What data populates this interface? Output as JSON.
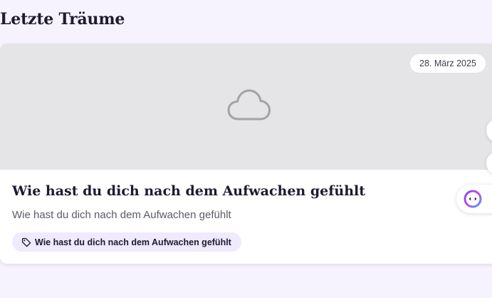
{
  "section": {
    "title": "Letzte Träume"
  },
  "dream_card": {
    "date": "28. März 2025",
    "title": "Wie hast du dich nach dem Aufwachen gefühlt",
    "description": "Wie hast du dich nach dem Aufwachen gefühlt",
    "tag_label": "Wie hast du dich nach dem Aufwachen gefühlt",
    "placeholder_icon": "cloud-icon",
    "tag_icon": "tag-icon"
  },
  "floating_actions": {
    "assistant_icon": "assistant-face-icon"
  },
  "colors": {
    "background": "#f6f3fe",
    "card_image_placeholder": "#e5e5e8",
    "tag_background": "#efeafd",
    "text_primary": "#1d1b2e",
    "text_secondary": "#5c5a66"
  }
}
